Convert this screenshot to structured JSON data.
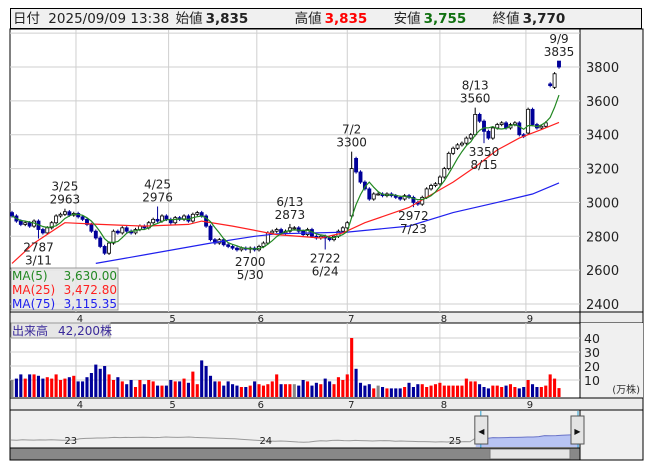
{
  "header": {
    "date_label": "日付",
    "datetime": "2025/09/09 13:38",
    "open_label": "始値",
    "open": "3,835",
    "high_label": "高値",
    "high": "3,835",
    "low_label": "安値",
    "low": "3,755",
    "close_label": "終値",
    "close": "3,770"
  },
  "legend": {
    "ma5_label": "MA(5)",
    "ma5_value": "3,630.00",
    "ma25_label": "MA(25)",
    "ma25_value": "3,472.80",
    "ma75_label": "MA(75)",
    "ma75_value": "3,115.35"
  },
  "volume_panel": {
    "label": "出来高",
    "value": "42,200株",
    "unit": "(万株)"
  },
  "colors": {
    "up_volume": "#ff0000",
    "down_volume": "#000099",
    "down_candle": "#000099",
    "ma5": "#228822",
    "ma25": "#ff2020",
    "ma75": "#2020ee",
    "nav_fill": "#b8c4f4"
  },
  "chart_data": {
    "type": "candlestick",
    "title": "",
    "price_axis": {
      "ticks": [
        2400,
        2600,
        2800,
        3000,
        3200,
        3400,
        3600,
        3800
      ],
      "ylim": [
        2385,
        3995
      ]
    },
    "volume_axis": {
      "ticks": [
        10,
        20,
        30,
        40
      ],
      "unit": "万株"
    },
    "months": [
      {
        "label": "4",
        "index": 14.5
      },
      {
        "label": "5",
        "index": 35.5
      },
      {
        "label": "6",
        "index": 55.5
      },
      {
        "label": "7",
        "index": 76.0
      },
      {
        "label": "8",
        "index": 97.0
      },
      {
        "label": "9",
        "index": 116.5
      }
    ],
    "closes": [
      2920,
      2890,
      2870,
      2880,
      2860,
      2890,
      2840,
      2820,
      2850,
      2880,
      2920,
      2930,
      2945,
      2925,
      2935,
      2915,
      2900,
      2870,
      2830,
      2790,
      2740,
      2700,
      2760,
      2830,
      2820,
      2850,
      2830,
      2820,
      2840,
      2860,
      2850,
      2880,
      2900,
      2890,
      2920,
      2900,
      2880,
      2910,
      2900,
      2920,
      2890,
      2930,
      2940,
      2920,
      2860,
      2780,
      2760,
      2780,
      2750,
      2740,
      2730,
      2720,
      2730,
      2725,
      2730,
      2720,
      2740,
      2760,
      2820,
      2830,
      2840,
      2820,
      2830,
      2850,
      2850,
      2830,
      2810,
      2840,
      2800,
      2790,
      2800,
      2790,
      2780,
      2800,
      2830,
      2850,
      2880,
      3200,
      3180,
      3120,
      3080,
      3020,
      3050,
      3050,
      3040,
      3050,
      3040,
      3030,
      3020,
      3040,
      3030,
      3000,
      2990,
      3030,
      3080,
      3100,
      3110,
      3150,
      3200,
      3290,
      3320,
      3340,
      3350,
      3380,
      3400,
      3520,
      3480,
      3420,
      3380,
      3440,
      3460,
      3470,
      3440,
      3460,
      3470,
      3400,
      3390,
      3550,
      3460,
      3440,
      3450,
      3470,
      3690,
      3760,
      3800
    ],
    "open_overrides": {
      "77": 2920,
      "78": 3260,
      "105": 3400,
      "117": 3410,
      "122": 3700,
      "123": 3680,
      "124": 3835
    },
    "volumes": [
      10,
      11,
      14,
      11,
      14,
      14,
      13,
      11,
      12,
      11,
      14,
      10,
      11,
      12,
      13,
      9,
      9,
      12,
      15,
      21,
      18,
      20,
      14,
      10,
      12,
      9,
      7,
      10,
      5,
      10,
      7,
      10,
      9,
      6,
      6,
      6,
      10,
      9,
      9,
      11,
      8,
      16,
      7,
      24,
      20,
      13,
      9,
      9,
      6,
      9,
      7,
      6,
      5,
      5,
      6,
      9,
      7,
      6,
      7,
      9,
      14,
      7,
      7,
      7,
      7,
      6,
      10,
      9,
      6,
      8,
      7,
      11,
      9,
      7,
      12,
      10,
      14,
      40,
      18,
      8,
      6,
      7,
      4,
      6,
      5,
      4,
      4,
      4,
      4,
      5,
      8,
      5,
      7,
      7,
      5,
      6,
      7,
      8,
      6,
      6,
      6,
      6,
      6,
      11,
      9,
      9,
      7,
      5,
      4,
      6,
      6,
      5,
      6,
      7,
      5,
      4,
      5,
      10,
      7,
      5,
      5,
      6,
      14,
      11,
      4.22
    ],
    "ma25": [
      [
        0,
        2640
      ],
      [
        5,
        2760
      ],
      [
        12,
        2880
      ],
      [
        20,
        2870
      ],
      [
        30,
        2860
      ],
      [
        40,
        2870
      ],
      [
        43,
        2890
      ],
      [
        50,
        2860
      ],
      [
        60,
        2810
      ],
      [
        70,
        2790
      ],
      [
        75,
        2820
      ],
      [
        80,
        2880
      ],
      [
        90,
        2970
      ],
      [
        100,
        3120
      ],
      [
        105,
        3210
      ],
      [
        110,
        3310
      ],
      [
        115,
        3380
      ],
      [
        120,
        3430
      ],
      [
        124,
        3472.8
      ]
    ],
    "ma75": [
      [
        19,
        2640
      ],
      [
        30,
        2690
      ],
      [
        45,
        2760
      ],
      [
        55,
        2800
      ],
      [
        60,
        2815
      ],
      [
        76,
        2825
      ],
      [
        90,
        2860
      ],
      [
        100,
        2940
      ],
      [
        110,
        3000
      ],
      [
        118,
        3050
      ],
      [
        124,
        3115.35
      ]
    ],
    "annotations": [
      {
        "index": 6,
        "date": "3/11",
        "value": "2787",
        "pos": "below"
      },
      {
        "index": 12,
        "date": "3/25",
        "value": "2963",
        "pos": "above"
      },
      {
        "index": 33,
        "date": "4/25",
        "value": "2976",
        "pos": "above"
      },
      {
        "index": 54,
        "date": "5/30",
        "value": "2700",
        "pos": "below"
      },
      {
        "index": 63,
        "date": "6/13",
        "value": "2873",
        "pos": "above"
      },
      {
        "index": 71,
        "date": "6/24",
        "value": "2722",
        "pos": "below"
      },
      {
        "index": 77,
        "date": "7/2",
        "value": "3300",
        "pos": "above"
      },
      {
        "index": 91,
        "date": "7/23",
        "value": "2972",
        "pos": "below"
      },
      {
        "index": 105,
        "date": "8/13",
        "value": "3560",
        "pos": "above"
      },
      {
        "index": 107,
        "date": "8/15",
        "value": "3350",
        "pos": "below"
      },
      {
        "index": 124,
        "date": "9/9",
        "value": "3835",
        "pos": "above"
      }
    ],
    "navigator": {
      "series": [
        2700,
        2690,
        2710,
        2700,
        2695,
        2705,
        2700,
        2710,
        2700,
        2690,
        2690,
        2700,
        2760,
        2780,
        2790,
        2800,
        2800,
        2810,
        2830,
        2820,
        2830,
        2825,
        2830,
        2840,
        2830,
        2820,
        2830,
        2850,
        2840,
        2830,
        2840,
        2850,
        2830,
        2820,
        2810,
        2800,
        2790,
        2780,
        2770,
        2760,
        2740,
        2720,
        2700,
        2680,
        2660,
        2650,
        2640,
        2650,
        2640,
        2620,
        2600,
        2590,
        2600,
        2640,
        2660,
        2650,
        2680,
        2690,
        2670,
        2660,
        2680,
        2670,
        2660,
        2650,
        2660,
        2670,
        2660,
        2640,
        2650,
        2640,
        2630,
        2620,
        2620,
        2610,
        2600,
        2610,
        2600,
        2610,
        2600,
        2620,
        2610,
        2800,
        2850,
        2780,
        2820,
        2810,
        2820,
        2830,
        2830,
        2840,
        2850,
        2850,
        2870,
        2920,
        2910,
        2920,
        2940,
        2950,
        2960,
        2990
      ],
      "year_labels": [
        {
          "label": "23",
          "index": 10
        },
        {
          "label": "24",
          "index": 44
        },
        {
          "label": "25",
          "index": 77
        }
      ],
      "selected_range": [
        0.826,
        1.0
      ]
    }
  }
}
